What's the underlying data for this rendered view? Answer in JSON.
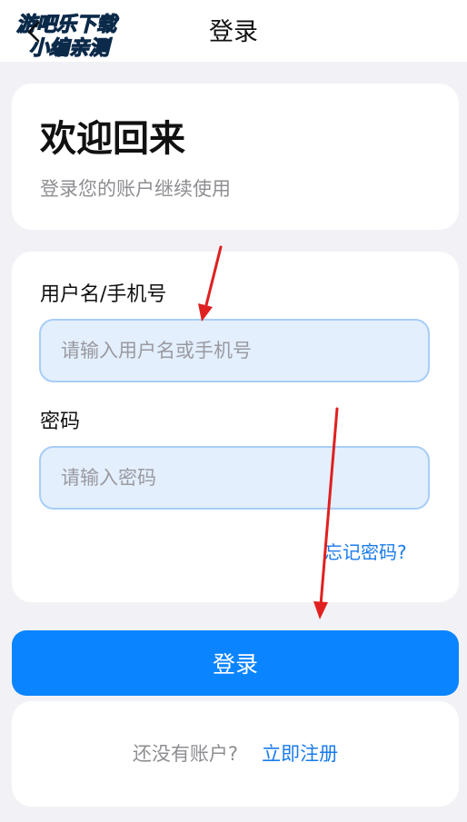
{
  "header": {
    "title": "登录",
    "watermark_line1": "游吧乐下载",
    "watermark_line2": "小编亲测"
  },
  "welcome": {
    "title": "欢迎回来",
    "subtitle": "登录您的账户继续使用"
  },
  "form": {
    "username_label": "用户名/手机号",
    "username_placeholder": "请输入用户名或手机号",
    "username_value": "",
    "password_label": "密码",
    "password_placeholder": "请输入密码",
    "password_value": "",
    "forgot_label": "忘记密码?"
  },
  "actions": {
    "login_label": "登录"
  },
  "register": {
    "prompt": "还没有账户?",
    "link_label": "立即注册"
  },
  "colors": {
    "accent": "#0a84ff",
    "link": "#1a7bea",
    "input_bg": "#e3effd",
    "input_border": "#a8cdf6",
    "page_bg": "#f2f2f6",
    "annotation_arrow": "#e02020",
    "watermark_fill": "#1dc8e6"
  },
  "icons": {
    "back": "chevron-left-icon",
    "annotation": "red-arrow-icon"
  }
}
